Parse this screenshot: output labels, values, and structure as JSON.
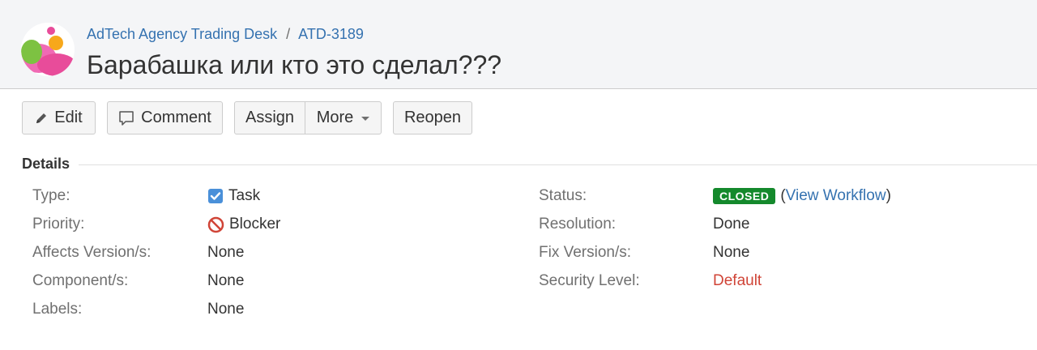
{
  "header": {
    "project": "AdTech Agency Trading Desk",
    "separator": "/",
    "issue_key": "ATD-3189",
    "title": "Барабашка или кто это сделал???"
  },
  "toolbar": {
    "edit": "Edit",
    "comment": "Comment",
    "assign": "Assign",
    "more": "More",
    "reopen": "Reopen"
  },
  "details": {
    "heading": "Details",
    "left": [
      {
        "label": "Type:",
        "value": "Task",
        "icon": "task-checkbox-icon"
      },
      {
        "label": "Priority:",
        "value": "Blocker",
        "icon": "blocker-priority-icon"
      },
      {
        "label": "Affects Version/s:",
        "value": "None"
      },
      {
        "label": "Component/s:",
        "value": "None"
      },
      {
        "label": "Labels:",
        "value": "None"
      }
    ],
    "right": [
      {
        "label": "Status:",
        "value": "CLOSED"
      },
      {
        "label": "Resolution:",
        "value": "Done"
      },
      {
        "label": "Fix Version/s:",
        "value": "None"
      },
      {
        "label": "Security Level:",
        "value": "Default"
      }
    ],
    "workflow_open": "(",
    "workflow_link": "View Workflow",
    "workflow_close": ")"
  },
  "colors": {
    "link": "#3572b0",
    "status_closed": "#14892c",
    "security_default": "#d04437",
    "blocker": "#d04437",
    "task_icon": "#4a6785"
  }
}
